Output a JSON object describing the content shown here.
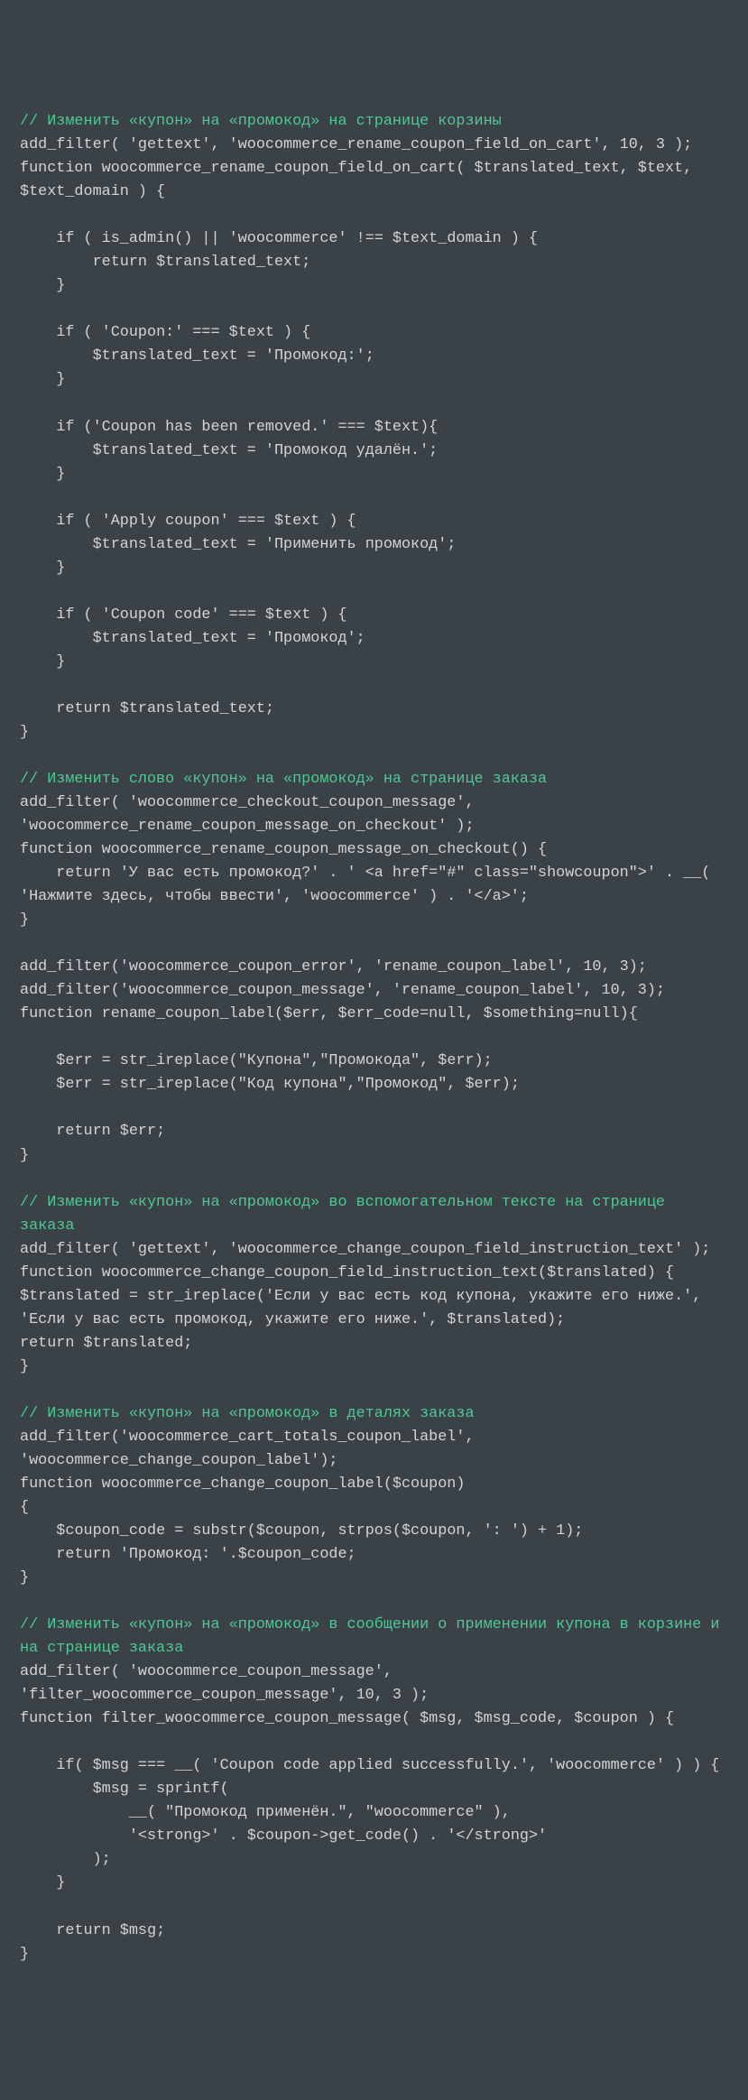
{
  "lines": [
    {
      "cls": "c",
      "text": "// Изменить «купон» на «промокод» на странице корзины"
    },
    {
      "cls": "k",
      "text": "add_filter( 'gettext', 'woocommerce_rename_coupon_field_on_cart', 10, 3 );"
    },
    {
      "cls": "k",
      "text": "function woocommerce_rename_coupon_field_on_cart( $translated_text, $text, $text_domain ) {"
    },
    {
      "cls": "k",
      "text": ""
    },
    {
      "cls": "k",
      "text": "    if ( is_admin() || 'woocommerce' !== $text_domain ) {"
    },
    {
      "cls": "k",
      "text": "        return $translated_text;"
    },
    {
      "cls": "k",
      "text": "    }"
    },
    {
      "cls": "k",
      "text": ""
    },
    {
      "cls": "k",
      "text": "    if ( 'Coupon:' === $text ) {"
    },
    {
      "cls": "k",
      "text": "        $translated_text = 'Промокод:';"
    },
    {
      "cls": "k",
      "text": "    }"
    },
    {
      "cls": "k",
      "text": ""
    },
    {
      "cls": "k",
      "text": "    if ('Coupon has been removed.' === $text){"
    },
    {
      "cls": "k",
      "text": "        $translated_text = 'Промокод удалён.';"
    },
    {
      "cls": "k",
      "text": "    }"
    },
    {
      "cls": "k",
      "text": ""
    },
    {
      "cls": "k",
      "text": "    if ( 'Apply coupon' === $text ) {"
    },
    {
      "cls": "k",
      "text": "        $translated_text = 'Применить промокод';"
    },
    {
      "cls": "k",
      "text": "    }"
    },
    {
      "cls": "k",
      "text": ""
    },
    {
      "cls": "k",
      "text": "    if ( 'Coupon code' === $text ) {"
    },
    {
      "cls": "k",
      "text": "        $translated_text = 'Промокод';"
    },
    {
      "cls": "k",
      "text": "    }"
    },
    {
      "cls": "k",
      "text": ""
    },
    {
      "cls": "k",
      "text": "    return $translated_text;"
    },
    {
      "cls": "k",
      "text": "}"
    },
    {
      "cls": "k",
      "text": ""
    },
    {
      "cls": "c",
      "text": "// Изменить слово «купон» на «промокод» на странице заказа"
    },
    {
      "cls": "k",
      "text": "add_filter( 'woocommerce_checkout_coupon_message', 'woocommerce_rename_coupon_message_on_checkout' );"
    },
    {
      "cls": "k",
      "text": "function woocommerce_rename_coupon_message_on_checkout() {"
    },
    {
      "cls": "k",
      "text": "    return 'У вас есть промокод?' . ' <a href=\"#\" class=\"showcoupon\">' . __( 'Нажмите здесь, чтобы ввести', 'woocommerce' ) . '</a>';"
    },
    {
      "cls": "k",
      "text": "}"
    },
    {
      "cls": "k",
      "text": ""
    },
    {
      "cls": "k",
      "text": "add_filter('woocommerce_coupon_error', 'rename_coupon_label', 10, 3);"
    },
    {
      "cls": "k",
      "text": "add_filter('woocommerce_coupon_message', 'rename_coupon_label', 10, 3);"
    },
    {
      "cls": "k",
      "text": "function rename_coupon_label($err, $err_code=null, $something=null){"
    },
    {
      "cls": "k",
      "text": ""
    },
    {
      "cls": "k",
      "text": "    $err = str_ireplace(\"Купона\",\"Промокода\", $err);"
    },
    {
      "cls": "k",
      "text": "    $err = str_ireplace(\"Код купона\",\"Промокод\", $err);"
    },
    {
      "cls": "k",
      "text": ""
    },
    {
      "cls": "k",
      "text": "    return $err;"
    },
    {
      "cls": "k",
      "text": "}"
    },
    {
      "cls": "k",
      "text": ""
    },
    {
      "cls": "c",
      "text": "// Изменить «купон» на «промокод» во вспомогательном тексте на странице заказа"
    },
    {
      "cls": "k",
      "text": "add_filter( 'gettext', 'woocommerce_change_coupon_field_instruction_text' );"
    },
    {
      "cls": "k",
      "text": "function woocommerce_change_coupon_field_instruction_text($translated) {"
    },
    {
      "cls": "k",
      "text": "$translated = str_ireplace('Если у вас есть код купона, укажите его ниже.', 'Если у вас есть промокод, укажите его ниже.', $translated);"
    },
    {
      "cls": "k",
      "text": "return $translated;"
    },
    {
      "cls": "k",
      "text": "}"
    },
    {
      "cls": "k",
      "text": ""
    },
    {
      "cls": "c",
      "text": "// Изменить «купон» на «промокод» в деталях заказа"
    },
    {
      "cls": "k",
      "text": "add_filter('woocommerce_cart_totals_coupon_label', 'woocommerce_change_coupon_label');"
    },
    {
      "cls": "k",
      "text": "function woocommerce_change_coupon_label($coupon)"
    },
    {
      "cls": "k",
      "text": "{"
    },
    {
      "cls": "k",
      "text": "    $coupon_code = substr($coupon, strpos($coupon, ': ') + 1);"
    },
    {
      "cls": "k",
      "text": "    return 'Промокод: '.$coupon_code;"
    },
    {
      "cls": "k",
      "text": "}"
    },
    {
      "cls": "k",
      "text": ""
    },
    {
      "cls": "c",
      "text": "// Изменить «купон» на «промокод» в сообщении о применении купона в корзине и на странице заказа"
    },
    {
      "cls": "k",
      "text": "add_filter( 'woocommerce_coupon_message', 'filter_woocommerce_coupon_message', 10, 3 );"
    },
    {
      "cls": "k",
      "text": "function filter_woocommerce_coupon_message( $msg, $msg_code, $coupon ) {"
    },
    {
      "cls": "k",
      "text": ""
    },
    {
      "cls": "k",
      "text": "    if( $msg === __( 'Coupon code applied successfully.', 'woocommerce' ) ) {"
    },
    {
      "cls": "k",
      "text": "        $msg = sprintf("
    },
    {
      "cls": "k",
      "text": "            __( \"Промокод применён.\", \"woocommerce\" ),"
    },
    {
      "cls": "k",
      "text": "            '<strong>' . $coupon->get_code() . '</strong>'"
    },
    {
      "cls": "k",
      "text": "        );"
    },
    {
      "cls": "k",
      "text": "    }"
    },
    {
      "cls": "k",
      "text": ""
    },
    {
      "cls": "k",
      "text": "    return $msg;"
    },
    {
      "cls": "k",
      "text": "}"
    }
  ]
}
